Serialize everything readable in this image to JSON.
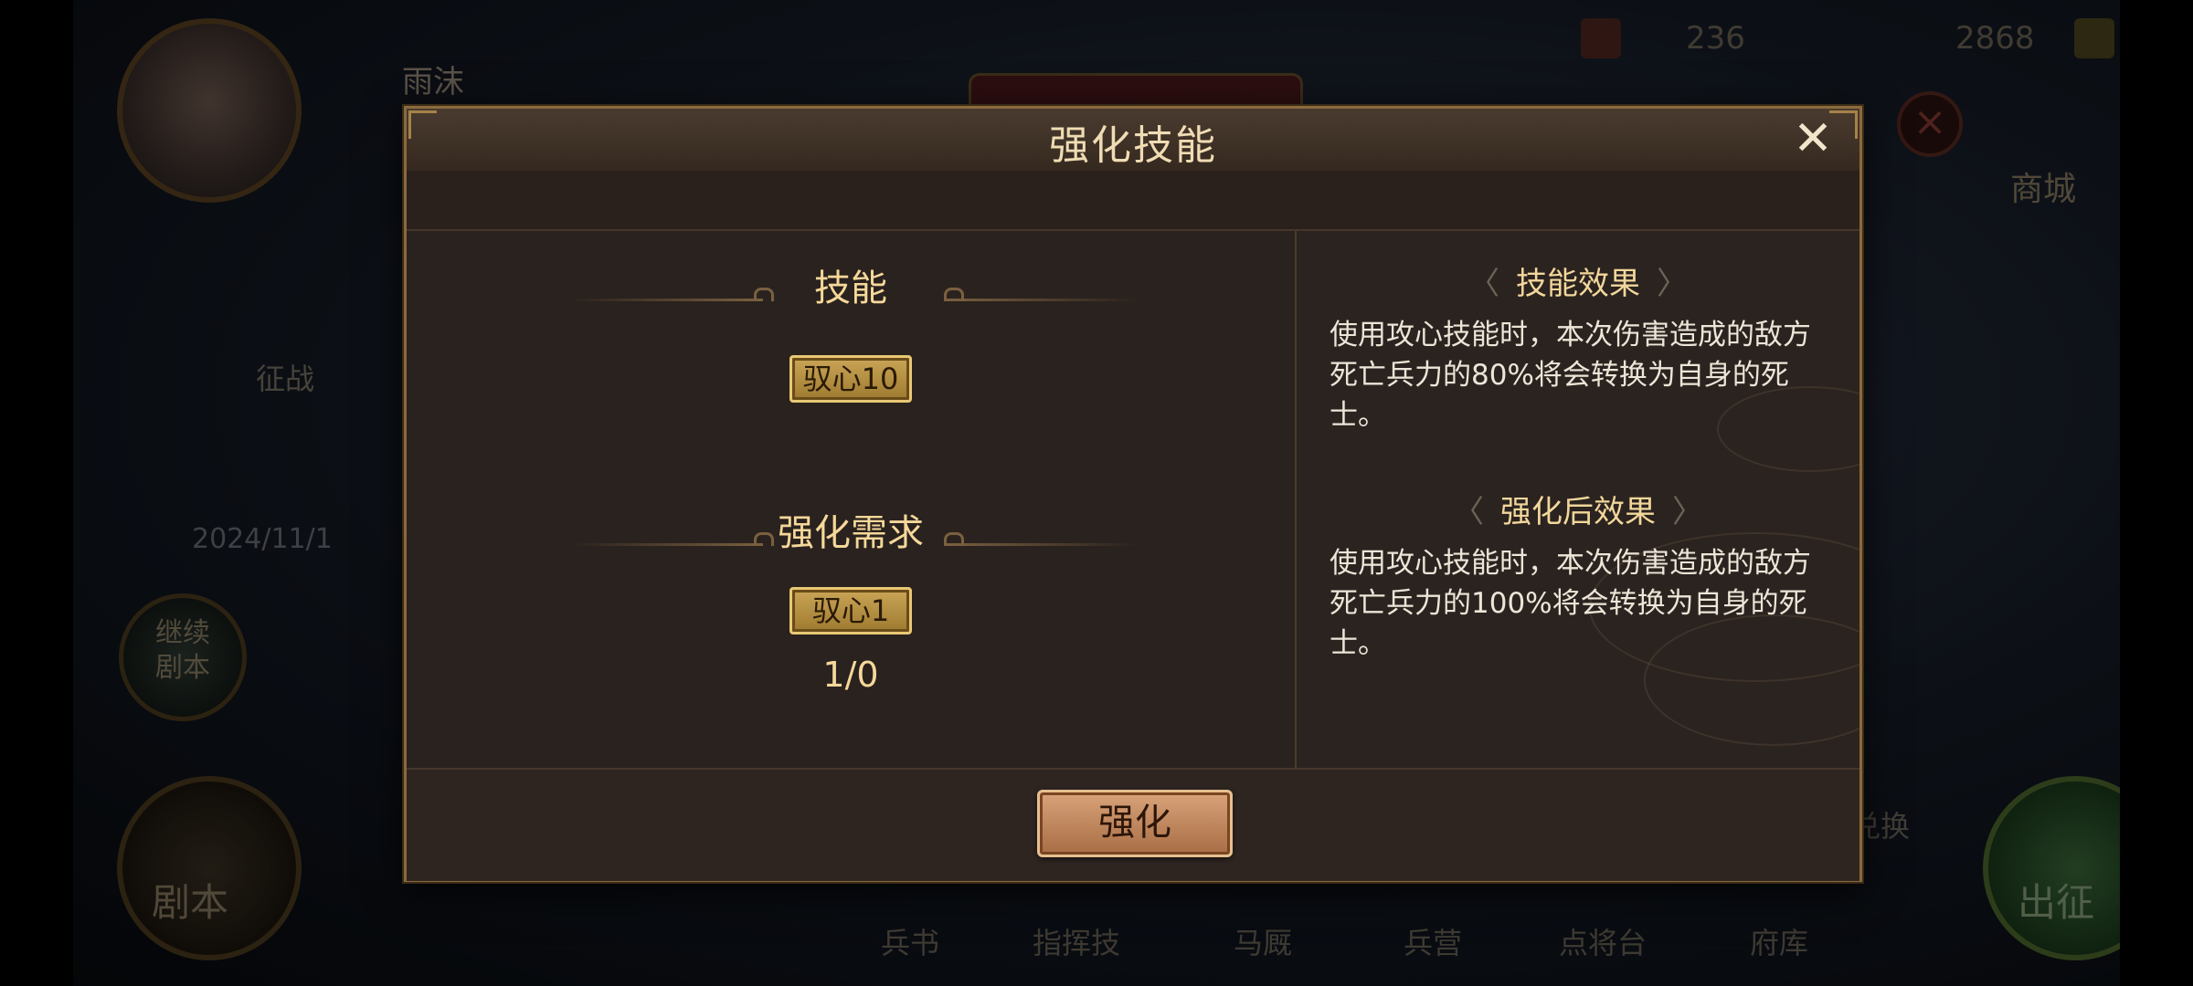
{
  "background": {
    "player_name": "雨沫",
    "tab_label": "府库",
    "resource_1": "236",
    "resource_2": "2868",
    "shop_label": "商城",
    "expedition_label": "征战",
    "date_label": "2024/11/1",
    "continue_label": "继续剧本",
    "script_label": "剧本",
    "exchange_label": "兑换",
    "go_label": "出征",
    "bottom_nav": [
      "兵书",
      "指挥技",
      "马厩",
      "兵营",
      "点将台",
      "府库"
    ]
  },
  "modal": {
    "title": "强化技能",
    "close_icon": "close-icon",
    "skill_section": {
      "title": "技能",
      "skill_chip": "驭心10"
    },
    "requirement_section": {
      "title": "强化需求",
      "required_chip": "驭心1",
      "progress": "1/0"
    },
    "effect_section": {
      "title": "技能效果",
      "text": "使用攻心技能时，本次伤害造成的敌方死亡兵力的80%将会转换为自身的死士。"
    },
    "after_effect_section": {
      "title": "强化后效果",
      "text": "使用攻心技能时，本次伤害造成的敌方死亡兵力的100%将会转换为自身的死士。"
    },
    "upgrade_button": "强化"
  },
  "colors": {
    "title_gold": "#f5d89a",
    "chip_gold": "#caa557",
    "button_copper": "#d9a37a",
    "panel_bg": "#2d2420"
  }
}
